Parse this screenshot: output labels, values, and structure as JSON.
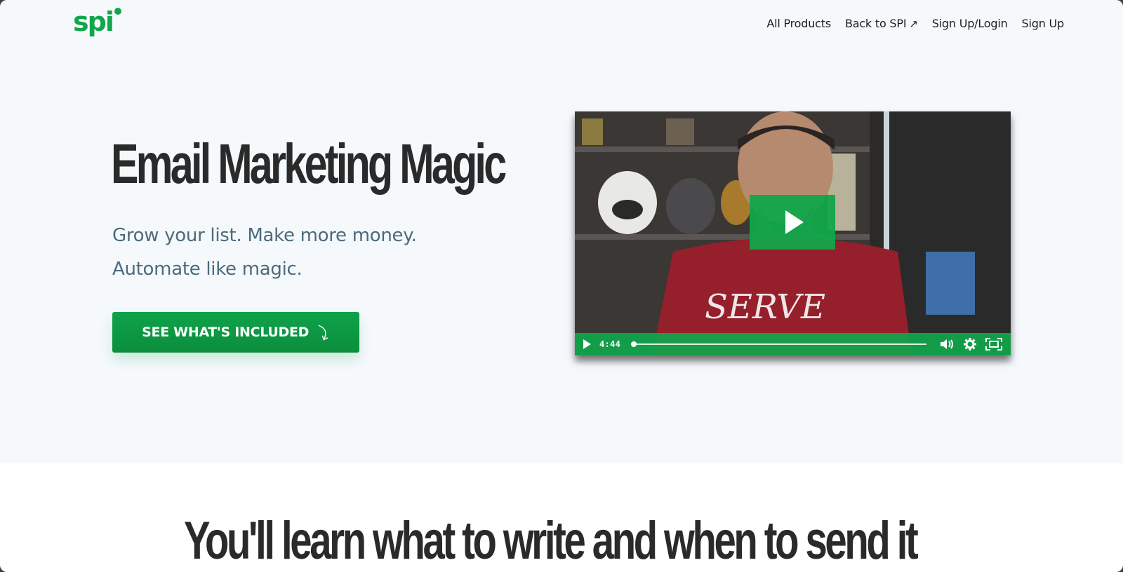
{
  "brand": {
    "logo_text": "spi",
    "accent_color": "#12a64a"
  },
  "nav": {
    "items": [
      {
        "label": "All Products"
      },
      {
        "label": "Back to SPI",
        "icon": "arrow-up-right-icon"
      },
      {
        "label": "Sign Up/Login"
      },
      {
        "label": "Sign Up"
      }
    ],
    "external_arrow": "↗"
  },
  "hero": {
    "title": "Email Marketing Magic",
    "subtitle_line1": "Grow your list. Make more money.",
    "subtitle_line2": "Automate like magic.",
    "cta_label": "SEE WHAT'S INCLUDED",
    "cta_icon": "curved-arrow-down-icon",
    "cta_glyph": "⤵"
  },
  "video": {
    "duration": "4:44",
    "progress_fraction": 0.0,
    "shirt_text": "SERVE",
    "controls": [
      "play-icon",
      "volume-icon",
      "settings-icon",
      "fullscreen-icon"
    ]
  },
  "section2": {
    "title": "You'll learn what to write and when to send it"
  }
}
